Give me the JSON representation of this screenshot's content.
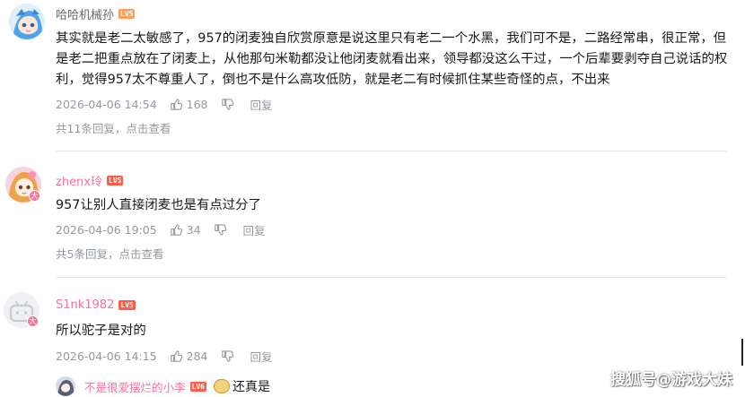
{
  "comments": [
    {
      "username": "哈哈机械孙",
      "level": "LV5",
      "text_lines": [
        "其实就是老二太敏感了，957的闭麦独自欣赏原意是说这里只有老二一个水黑，我们可不是，二路经常串，很正常，但",
        "是老二把重点放在了闭麦上，从他那句米勒都没让他闭麦就看出来，领导都没这么干过，一个后辈要剥夺自己说话的权",
        "利，觉得957太不尊重人了，倒也不是什么高攻低防，就是老二有时候抓住某些奇怪的点，不出来"
      ],
      "date": "2026-04-06 14:54",
      "likes": "168",
      "reply_label": "回复",
      "reply_count_text": "共11条回复，",
      "view_link": "点击查看"
    },
    {
      "username": "zhenx玲",
      "level": "LV5",
      "text_lines": [
        "957让别人直接闭麦也是有点过分了"
      ],
      "date": "2026-04-06 19:05",
      "likes": "34",
      "reply_label": "回复",
      "reply_count_text": "共5条回复，",
      "view_link": "点击查看"
    },
    {
      "username": "S1nk1982",
      "level": "LV5",
      "text_lines": [
        "所以驼子是对的"
      ],
      "date": "2026-04-06 14:15",
      "likes": "284",
      "reply_label": "回复"
    }
  ],
  "sub_reply": {
    "username": "不是很爱摆烂的小李",
    "level": "LV6",
    "text": "还真是"
  },
  "watermark": "搜狐号@游戏大妹",
  "icons": {
    "like": "thumbs-up-icon",
    "dislike": "thumbs-down-icon",
    "badge": "avatar-badge-icon",
    "emoji": "laughing-emoji-icon"
  },
  "colors": {
    "primary_text": "#18191c",
    "secondary_text": "#9499a0",
    "username": "#61666d",
    "vip_pink": "#fb7299",
    "level_orange": "#ff9f5a",
    "level_red": "#ff5d47",
    "divider": "#e3e5e7"
  }
}
